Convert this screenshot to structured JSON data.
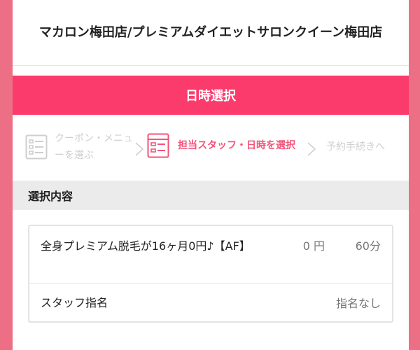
{
  "header": {
    "title": "マカロン梅田店/プレミアムダイエットサロンクイーン梅田店"
  },
  "page_heading": "日時選択",
  "steps": [
    {
      "label": "クーポン・メニューを選ぶ"
    },
    {
      "label": "担当スタッフ・日時を選択"
    },
    {
      "label": "予約手続きへ"
    }
  ],
  "section": {
    "title": "選択内容",
    "menu_item": {
      "name": "全身プレミアム脱毛が16ヶ月0円♪【AF】",
      "price": "0 円",
      "duration": "60分"
    },
    "staff": {
      "label": "スタッフ指名",
      "value": "指名なし"
    }
  },
  "colors": {
    "background": "#ec6f86",
    "accent": "#fc3b6d",
    "active_step": "#f2547a",
    "inactive_step": "#cfcfcf"
  }
}
